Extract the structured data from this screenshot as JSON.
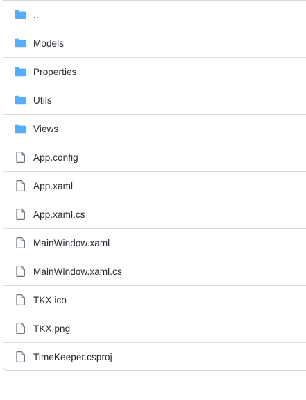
{
  "colors": {
    "folder": "#54aeff",
    "file_outline": "#57606a",
    "border": "#d0d7de",
    "text": "#24292f"
  },
  "entries": [
    {
      "type": "folder",
      "icon": "folder-icon",
      "label": ".."
    },
    {
      "type": "folder",
      "icon": "folder-icon",
      "label": "Models"
    },
    {
      "type": "folder",
      "icon": "folder-icon",
      "label": "Properties"
    },
    {
      "type": "folder",
      "icon": "folder-icon",
      "label": "Utils"
    },
    {
      "type": "folder",
      "icon": "folder-icon",
      "label": "Views"
    },
    {
      "type": "file",
      "icon": "file-icon",
      "label": "App.config"
    },
    {
      "type": "file",
      "icon": "file-icon",
      "label": "App.xaml"
    },
    {
      "type": "file",
      "icon": "file-icon",
      "label": "App.xaml.cs"
    },
    {
      "type": "file",
      "icon": "file-icon",
      "label": "MainWindow.xaml"
    },
    {
      "type": "file",
      "icon": "file-icon",
      "label": "MainWindow.xaml.cs"
    },
    {
      "type": "file",
      "icon": "file-icon",
      "label": "TKX.ico"
    },
    {
      "type": "file",
      "icon": "file-icon",
      "label": "TKX.png"
    },
    {
      "type": "file",
      "icon": "file-icon",
      "label": "TimeKeeper.csproj"
    }
  ]
}
